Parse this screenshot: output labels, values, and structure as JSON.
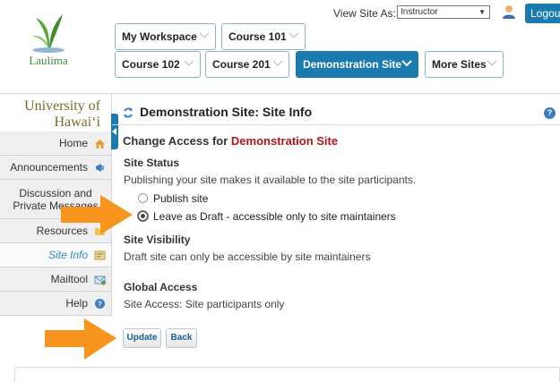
{
  "header": {
    "brand": "Laulima",
    "view_site_as_label": "View Site As:",
    "role_selected": "Instructor",
    "logout_label": "Logout",
    "site_tabs": [
      {
        "label": "My Workspace"
      },
      {
        "label": "Course 101"
      },
      {
        "label": "Course 102"
      },
      {
        "label": "Course 201"
      },
      {
        "label": "Demonstration Site",
        "active": true
      },
      {
        "label": "More Sites"
      }
    ]
  },
  "sidebar": {
    "institution_line1": "University of",
    "institution_line2": "Hawaiʻi",
    "items": [
      {
        "label": "Home",
        "icon": "home-icon"
      },
      {
        "label": "Announcements",
        "icon": "megaphone-icon"
      },
      {
        "label": "Discussion and Private Messages",
        "icon": "messages-icon"
      },
      {
        "label": "Resources",
        "icon": "folder-icon"
      },
      {
        "label": "Site Info",
        "icon": "site-info-icon",
        "current": true
      },
      {
        "label": "Mailtool",
        "icon": "mail-icon"
      },
      {
        "label": "Help",
        "icon": "help-icon"
      }
    ]
  },
  "main": {
    "tool_title": "Demonstration Site: Site Info",
    "change_access_prefix": "Change Access for ",
    "site_name": "Demonstration Site",
    "site_status_heading": "Site Status",
    "site_status_text": "Publishing your site makes it available to the site participants.",
    "options": [
      {
        "label": "Publish site",
        "checked": false
      },
      {
        "label": "Leave as Draft - accessible only to site maintainers",
        "checked": true
      }
    ],
    "visibility_heading": "Site Visibility",
    "visibility_text": "Draft site can only be accessible by site maintainers",
    "global_heading": "Global Access",
    "global_text": "Site Access: Site participants only",
    "update_label": "Update",
    "back_label": "Back"
  },
  "colors": {
    "brand_blue": "#1b7bb0",
    "site_red": "#b3141b",
    "arrow_orange": "#f7941d"
  }
}
